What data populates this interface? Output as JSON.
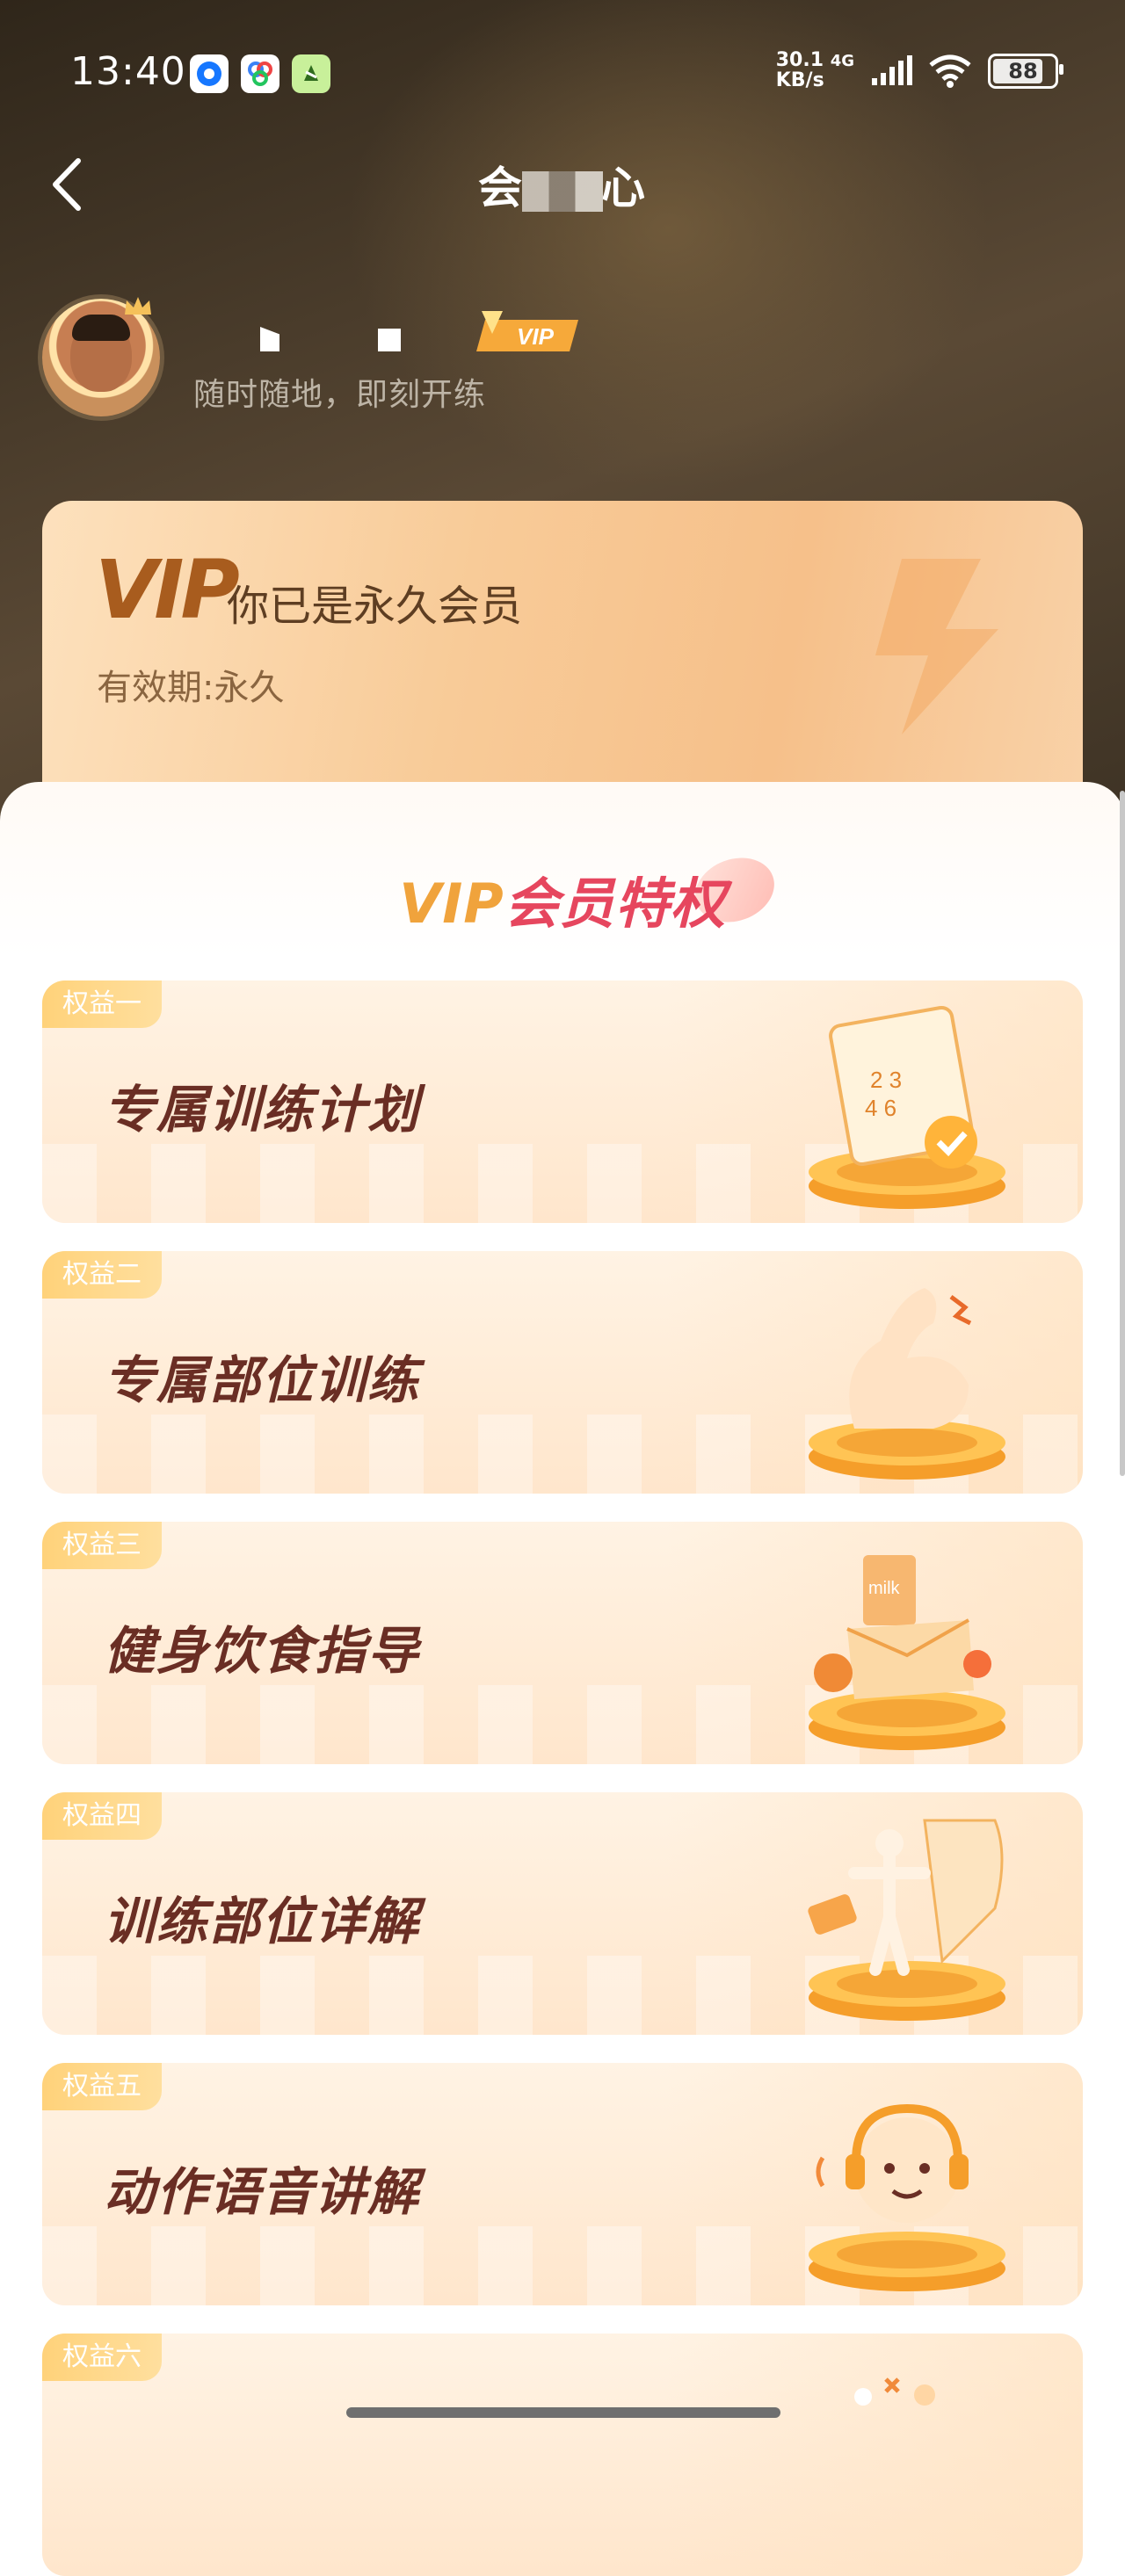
{
  "status_bar": {
    "time": "13:40",
    "net_speed_value": "30.1",
    "net_speed_unit": "KB/s",
    "network_type": "4G",
    "battery": "88"
  },
  "header": {
    "title_left": "会",
    "title_right": "心"
  },
  "profile": {
    "slogan": "随时随地，即刻开练",
    "vip_badge": "VIP"
  },
  "vip_card": {
    "logo": "VIP",
    "title": "你已是永久会员",
    "expiry": "有效期:永久"
  },
  "privileges": {
    "title_vip": "VIP",
    "title_rest": "会员特权",
    "items": [
      {
        "tag": "权益一",
        "title": "专属训练计划",
        "icon": "calendar-icon"
      },
      {
        "tag": "权益二",
        "title": "专属部位训练",
        "icon": "muscle-arm-icon"
      },
      {
        "tag": "权益三",
        "title": "健身饮食指导",
        "icon": "food-box-icon"
      },
      {
        "tag": "权益四",
        "title": "训练部位详解",
        "icon": "body-figure-icon"
      },
      {
        "tag": "权益五",
        "title": "动作语音讲解",
        "icon": "headset-person-icon"
      },
      {
        "tag": "权益六",
        "title": "",
        "icon": "decor-icon"
      }
    ]
  },
  "colors": {
    "header_dark": "#3d3224",
    "gold": "#f0a33c",
    "red_title": "#e6465e",
    "benefit_title": "#6a2e24"
  }
}
